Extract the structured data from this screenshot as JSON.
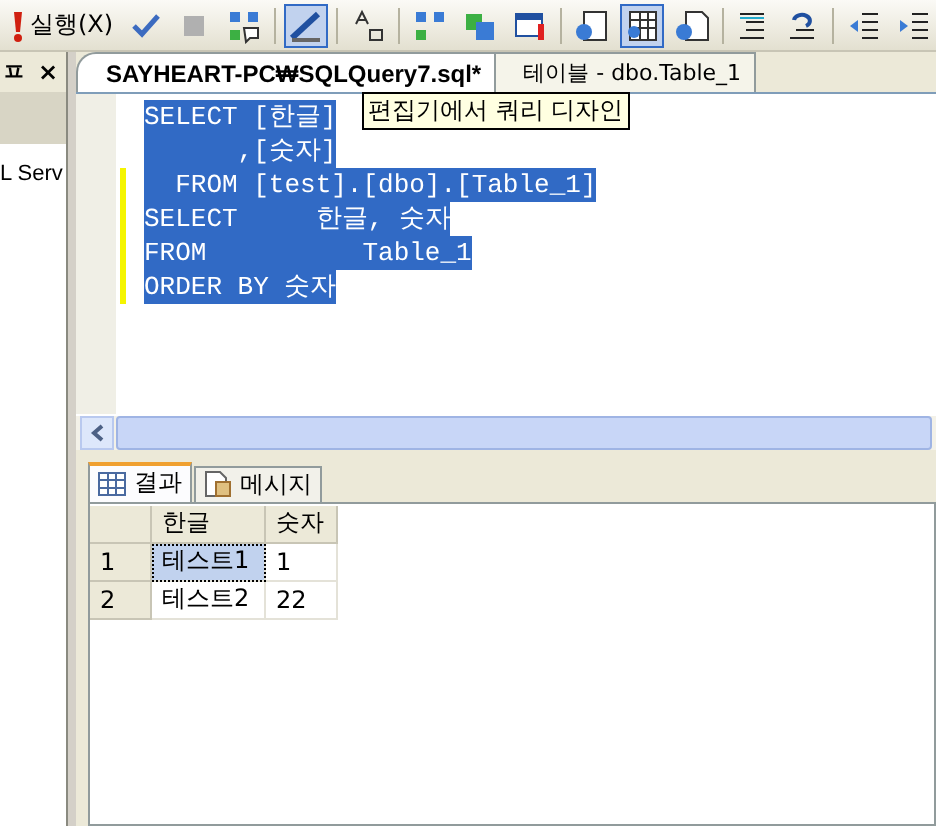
{
  "toolbar": {
    "run_label": "실행(X)",
    "buttons": [
      {
        "selected": false
      },
      {
        "selected": false
      },
      {
        "selected": false
      },
      {
        "selected": true
      },
      {
        "selected": false
      },
      {
        "selected": false
      },
      {
        "selected": false
      },
      {
        "selected": false
      },
      {
        "selected": false
      },
      {
        "selected": true
      },
      {
        "selected": false
      },
      {
        "selected": false
      },
      {
        "selected": false
      },
      {
        "selected": false
      },
      {
        "selected": false
      }
    ]
  },
  "side_panel": {
    "pin": "ㅍ",
    "close": "×",
    "item": "L Serv"
  },
  "editor_tabs": [
    {
      "label": "SAYHEART-PC₩SQLQuery7.sql*",
      "selected": true
    },
    {
      "label": "테이블 - dbo.Table_1",
      "selected": false
    }
  ],
  "tooltip": "편집기에서 쿼리 디자인",
  "code_lines": [
    {
      "text": "SELECT [한글]",
      "changed": false
    },
    {
      "text": "      ,[숫자]",
      "changed": false
    },
    {
      "text": "  FROM [test].[dbo].[Table_1]",
      "changed": true
    },
    {
      "text": "SELECT     한글, 숫자",
      "changed": true
    },
    {
      "text": "FROM          Table_1",
      "changed": true
    },
    {
      "text": "ORDER BY 숫자",
      "changed": true
    }
  ],
  "result_tabs": [
    {
      "label": "결과",
      "selected": true
    },
    {
      "label": "메시지",
      "selected": false
    }
  ],
  "grid": {
    "columns": [
      "한글",
      "숫자"
    ],
    "rows": [
      {
        "number": "1",
        "cells": [
          "테스트1",
          "1"
        ],
        "selected": true
      },
      {
        "number": "2",
        "cells": [
          "테스트2",
          "22"
        ],
        "selected": false
      }
    ]
  }
}
